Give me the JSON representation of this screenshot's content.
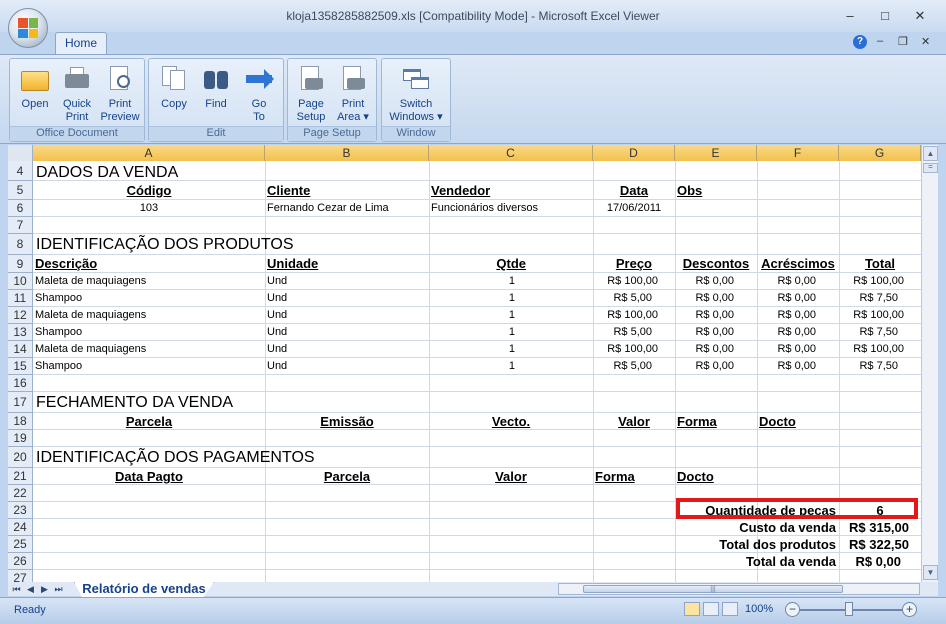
{
  "window": {
    "title": "kloja1358285882509.xls  [Compatibility Mode] - Microsoft Excel Viewer",
    "minimize": "–",
    "maximize": "□",
    "close": "✕"
  },
  "tabs": {
    "home": "Home"
  },
  "mdi": {
    "help": "?",
    "minimize": "–",
    "restore": "❐",
    "close": "✕"
  },
  "ribbon": {
    "groups": [
      {
        "label": "Office Document",
        "buttons": [
          {
            "label1": "Open",
            "label2": "",
            "icon": "open-folder-icon"
          },
          {
            "label1": "Quick",
            "label2": "Print",
            "icon": "quick-print-icon"
          },
          {
            "label1": "Print",
            "label2": "Preview",
            "icon": "print-preview-icon"
          }
        ]
      },
      {
        "label": "Edit",
        "buttons": [
          {
            "label1": "Copy",
            "label2": "",
            "icon": "copy-icon"
          },
          {
            "label1": "Find",
            "label2": "",
            "icon": "binoculars-icon"
          },
          {
            "label1": "Go",
            "label2": "To",
            "icon": "go-to-arrow-icon"
          }
        ]
      },
      {
        "label": "Page Setup",
        "buttons": [
          {
            "label1": "Page",
            "label2": "Setup",
            "icon": "page-setup-icon"
          },
          {
            "label1": "Print",
            "label2": "Area ▾",
            "icon": "print-area-icon"
          }
        ]
      },
      {
        "label": "Window",
        "buttons": [
          {
            "label1": "Switch",
            "label2": "Windows ▾",
            "icon": "switch-windows-icon"
          }
        ]
      }
    ]
  },
  "columns": [
    "A",
    "B",
    "C",
    "D",
    "E",
    "F",
    "G"
  ],
  "rows": [
    "4",
    "5",
    "6",
    "7",
    "8",
    "9",
    "10",
    "11",
    "12",
    "13",
    "14",
    "15",
    "16",
    "17",
    "18",
    "19",
    "20",
    "21",
    "22",
    "23",
    "24",
    "25",
    "26",
    "27"
  ],
  "sheet": {
    "r4": {
      "a": "DADOS DA VENDA"
    },
    "r5": {
      "a": "Código",
      "b": "Cliente",
      "c": "Vendedor",
      "d": "Data",
      "e": "Obs"
    },
    "r6": {
      "a": "103",
      "b": "Fernando Cezar de Lima",
      "c": "Funcionários diversos",
      "d": "17/06/2011"
    },
    "r8": {
      "a": "IDENTIFICAÇÃO DOS PRODUTOS"
    },
    "r9": {
      "a": "Descrição",
      "b": "Unidade",
      "c": "Qtde",
      "d": "Preço",
      "e": "Descontos",
      "f": "Acréscimos",
      "g": "Total"
    },
    "products": [
      {
        "desc": "Maleta de maquiagens",
        "unit": "Und",
        "qty": "1",
        "price": "R$ 100,00",
        "disc": "R$ 0,00",
        "add": "R$ 0,00",
        "total": "R$ 100,00"
      },
      {
        "desc": "Shampoo",
        "unit": "Und",
        "qty": "1",
        "price": "R$ 5,00",
        "disc": "R$ 0,00",
        "add": "R$ 0,00",
        "total": "R$ 7,50"
      },
      {
        "desc": "Maleta de maquiagens",
        "unit": "Und",
        "qty": "1",
        "price": "R$ 100,00",
        "disc": "R$ 0,00",
        "add": "R$ 0,00",
        "total": "R$ 100,00"
      },
      {
        "desc": "Shampoo",
        "unit": "Und",
        "qty": "1",
        "price": "R$ 5,00",
        "disc": "R$ 0,00",
        "add": "R$ 0,00",
        "total": "R$ 7,50"
      },
      {
        "desc": "Maleta de maquiagens",
        "unit": "Und",
        "qty": "1",
        "price": "R$ 100,00",
        "disc": "R$ 0,00",
        "add": "R$ 0,00",
        "total": "R$ 100,00"
      },
      {
        "desc": "Shampoo",
        "unit": "Und",
        "qty": "1",
        "price": "R$ 5,00",
        "disc": "R$ 0,00",
        "add": "R$ 0,00",
        "total": "R$ 7,50"
      }
    ],
    "r17": {
      "a": "FECHAMENTO DA VENDA"
    },
    "r18": {
      "a": "Parcela",
      "b": "Emissão",
      "c": "Vecto.",
      "d": "Valor",
      "e": "Forma",
      "f": "Docto"
    },
    "r20": {
      "a": "IDENTIFICAÇÃO DOS PAGAMENTOS"
    },
    "r21": {
      "a": "Data Pagto",
      "b": "Parcela",
      "c": "Valor",
      "d": "Forma",
      "e": "Docto"
    },
    "r23": {
      "label": "Quantidade de peças",
      "value": "6"
    },
    "r24": {
      "label": "Custo da venda",
      "value": "R$ 315,00"
    },
    "r25": {
      "label": "Total dos produtos",
      "value": "R$ 322,50"
    },
    "r26": {
      "label": "Total da venda",
      "value": "R$ 0,00"
    }
  },
  "sheet_tab": "Relatório de vendas",
  "status": {
    "ready": "Ready",
    "zoom": "100%"
  },
  "colors": {
    "highlight": "#e11919",
    "col_header": "#f3c14b"
  }
}
